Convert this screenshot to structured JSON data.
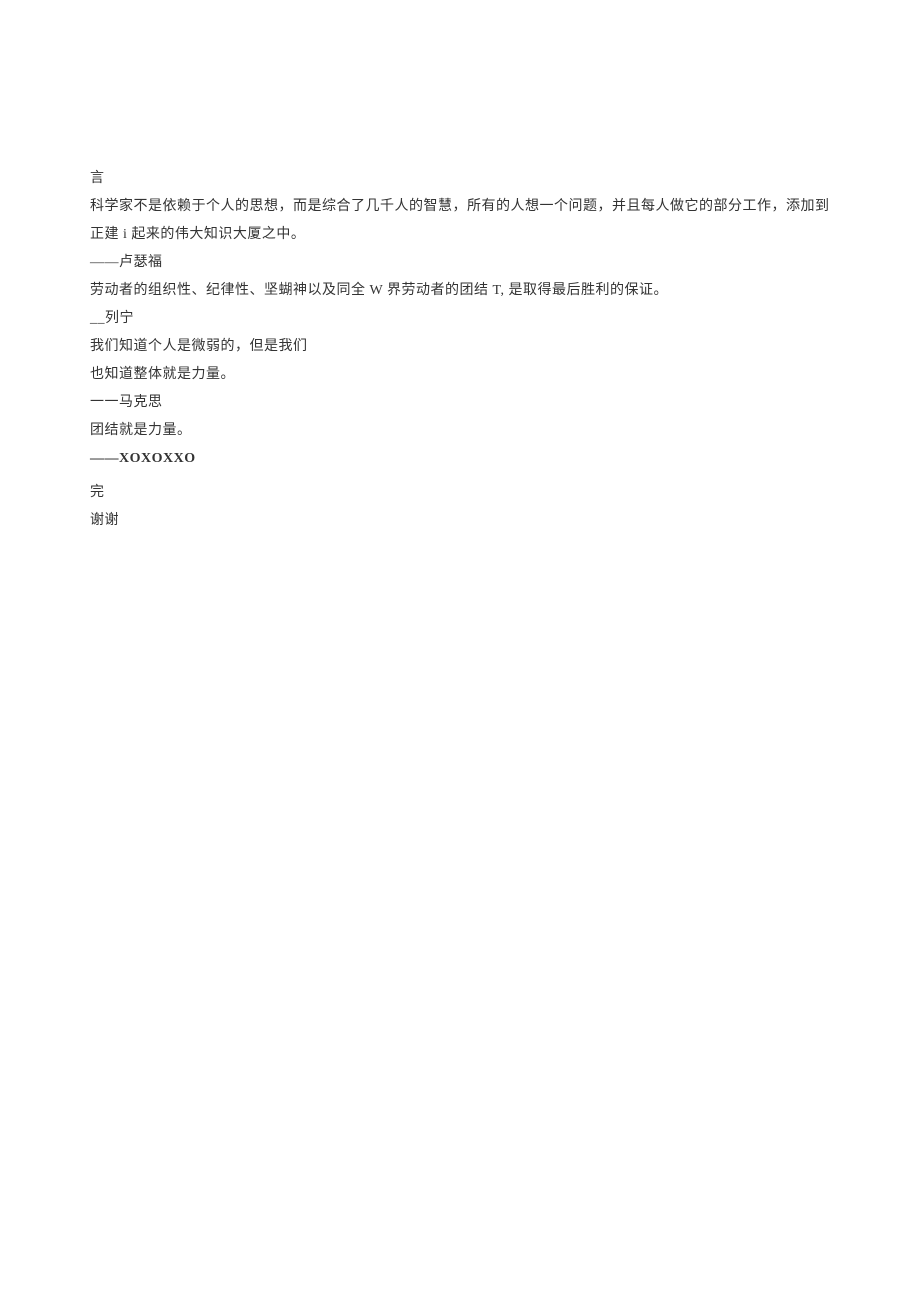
{
  "lines": {
    "l1": "言",
    "l2": "科学家不是依赖于个人的思想，而是综合了几千人的智慧，所有的人想一个问题，并且每人做它的部分工作，添加到正建 i 起来的伟大知识大厦之中。",
    "l3": "——卢瑟福",
    "l4": "劳动者的组织性、纪律性、坚蝴神以及同全 W 界劳动者的团结 T, 是取得最后胜利的保证。",
    "l5": "__列宁",
    "l6": "我们知道个人是微弱的，但是我们",
    "l7": "也知道整体就是力量。",
    "l8": "一一马克思",
    "l9": "团结就是力量。",
    "l10": "——XOXOXXO",
    "l11": "完",
    "l12": "谢谢"
  }
}
